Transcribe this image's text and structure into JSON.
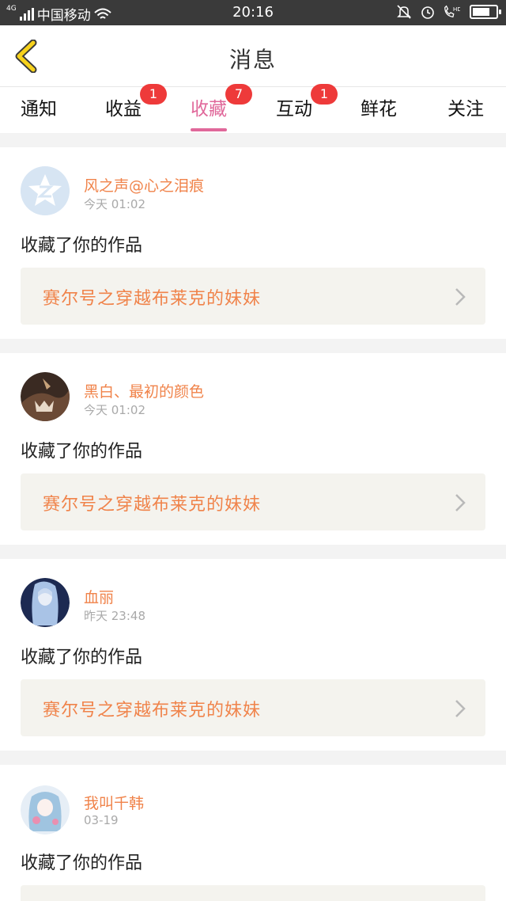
{
  "status_bar": {
    "network": "4G",
    "carrier": "中国移动",
    "time": "20:16",
    "battery_level": 0.75
  },
  "header": {
    "title": "消息"
  },
  "tabs": [
    {
      "label": "通知",
      "badge": "",
      "active": false
    },
    {
      "label": "收益",
      "badge": "1",
      "active": false
    },
    {
      "label": "收藏",
      "badge": "7",
      "active": true
    },
    {
      "label": "互动",
      "badge": "1",
      "active": false
    },
    {
      "label": "鲜花",
      "badge": "",
      "active": false
    },
    {
      "label": "关注",
      "badge": "",
      "active": false
    }
  ],
  "messages": [
    {
      "username": "风之声@心之泪痕",
      "time": "今天 01:02",
      "action": "收藏了你的作品",
      "work_title": "赛尔号之穿越布莱克的妹妹"
    },
    {
      "username": "黑白、最初的颜色",
      "time": "今天 01:02",
      "action": "收藏了你的作品",
      "work_title": "赛尔号之穿越布莱克的妹妹"
    },
    {
      "username": "血丽",
      "time": "昨天 23:48",
      "action": "收藏了你的作品",
      "work_title": "赛尔号之穿越布莱克的妹妹"
    },
    {
      "username": "我叫千韩",
      "time": "03-19",
      "action": "收藏了你的作品",
      "work_title": ""
    }
  ],
  "colors": {
    "accent": "#e0689a",
    "orange": "#f0834a",
    "badge": "#ee3a3a"
  }
}
